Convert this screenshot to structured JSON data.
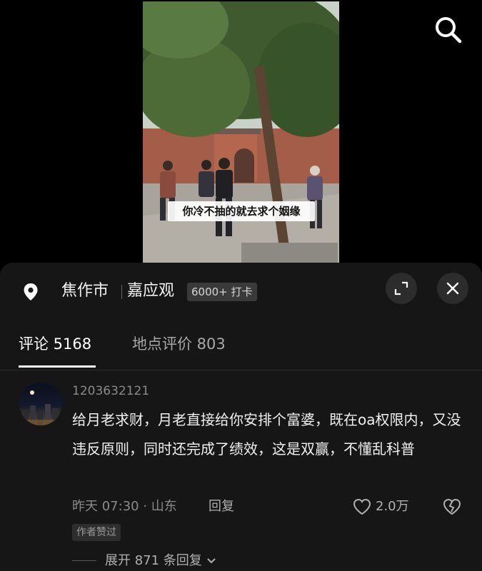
{
  "video": {
    "subtitle": "你冷不抽的就去求个姻缘"
  },
  "location": {
    "city": "焦作市",
    "place": "嘉应观",
    "checkin_badge": "6000+ 打卡"
  },
  "tabs": [
    {
      "label": "评论 5168",
      "active": true
    },
    {
      "label": "地点评价 803",
      "active": false
    }
  ],
  "comment": {
    "username": "1203632121",
    "text": "给月老求财，月老直接给你安排个富婆，既在oa权限内，又没违反原则，同时还完成了绩效，这是双赢，不懂乱科普",
    "time_location": "昨天 07:30 · 山东",
    "reply_label": "回复",
    "like_count": "2.0万",
    "author_badge": "作者赞过",
    "expand_label": "展开 871 条回复"
  },
  "colors": {
    "sheet_bg": "#161616",
    "text_primary": "#f0f0f0",
    "text_secondary": "#8a8a8a"
  },
  "icons": {
    "search": "search-icon",
    "pin": "location-pin-icon",
    "expand": "expand-icon",
    "close": "close-icon",
    "like": "heart-icon",
    "dislike": "broken-heart-icon",
    "chevron": "chevron-down-icon"
  }
}
